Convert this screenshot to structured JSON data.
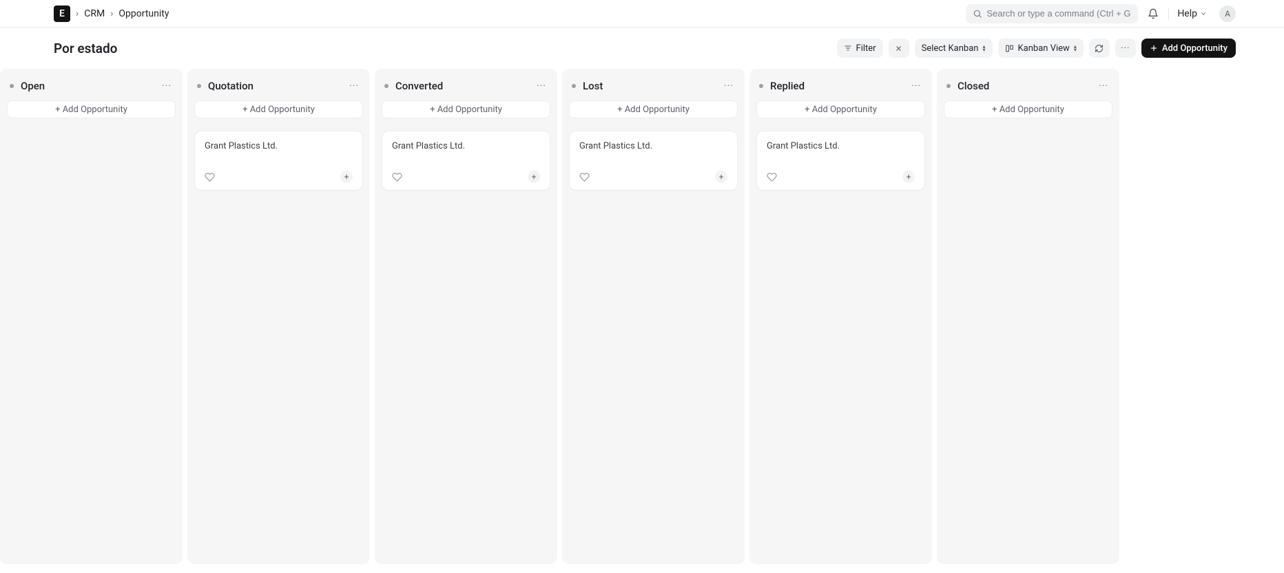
{
  "header": {
    "logo_letter": "E",
    "breadcrumbs": [
      "CRM",
      "Opportunity"
    ],
    "search_placeholder": "Search or type a command (Ctrl + G)",
    "help_label": "Help",
    "avatar_initial": "A"
  },
  "subheader": {
    "title": "Por estado",
    "filter_label": "Filter",
    "select_kanban_label": "Select Kanban",
    "view_label": "Kanban View",
    "add_button_label": "Add Opportunity"
  },
  "board": {
    "add_label": "+ Add Opportunity",
    "columns": [
      {
        "name": "Open",
        "dot": "#9aa0a6",
        "cards": []
      },
      {
        "name": "Quotation",
        "dot": "#9aa0a6",
        "cards": [
          {
            "title": "Grant Plastics Ltd."
          }
        ]
      },
      {
        "name": "Converted",
        "dot": "#9aa0a6",
        "cards": [
          {
            "title": "Grant Plastics Ltd."
          }
        ]
      },
      {
        "name": "Lost",
        "dot": "#9aa0a6",
        "cards": [
          {
            "title": "Grant Plastics Ltd."
          }
        ]
      },
      {
        "name": "Replied",
        "dot": "#9aa0a6",
        "cards": [
          {
            "title": "Grant Plastics Ltd."
          }
        ]
      },
      {
        "name": "Closed",
        "dot": "#9aa0a6",
        "cards": []
      }
    ]
  }
}
